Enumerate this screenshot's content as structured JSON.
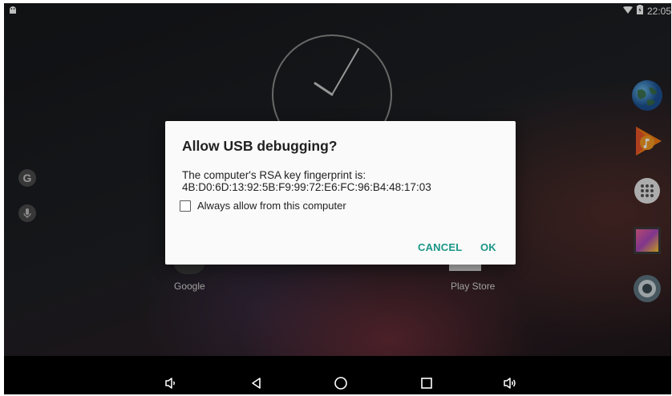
{
  "status_bar": {
    "time": "22:05",
    "icons": [
      "android-debug-icon",
      "wifi-icon",
      "battery-icon"
    ]
  },
  "home": {
    "labels": {
      "google": "Google",
      "play_store": "Play Store"
    },
    "right_dock": [
      "globe-icon",
      "play-music-icon",
      "app-drawer-icon",
      "gallery-icon",
      "camera-icon"
    ],
    "left_icons": [
      "google-search-icon",
      "voice-search-icon"
    ]
  },
  "dialog": {
    "title": "Allow USB debugging?",
    "message_line1": "The computer's RSA key fingerprint is:",
    "message_line2": "4B:D0:6D:13:92:5B:F9:99:72:E6:FC:96:B4:48:17:03",
    "checkbox_label": "Always allow from this computer",
    "checkbox_checked": false,
    "cancel_label": "CANCEL",
    "ok_label": "OK",
    "accent_color": "#1a9688"
  },
  "nav_bar": {
    "buttons": [
      "volume-down-icon",
      "back-icon",
      "home-icon",
      "recents-icon",
      "volume-up-icon"
    ]
  }
}
